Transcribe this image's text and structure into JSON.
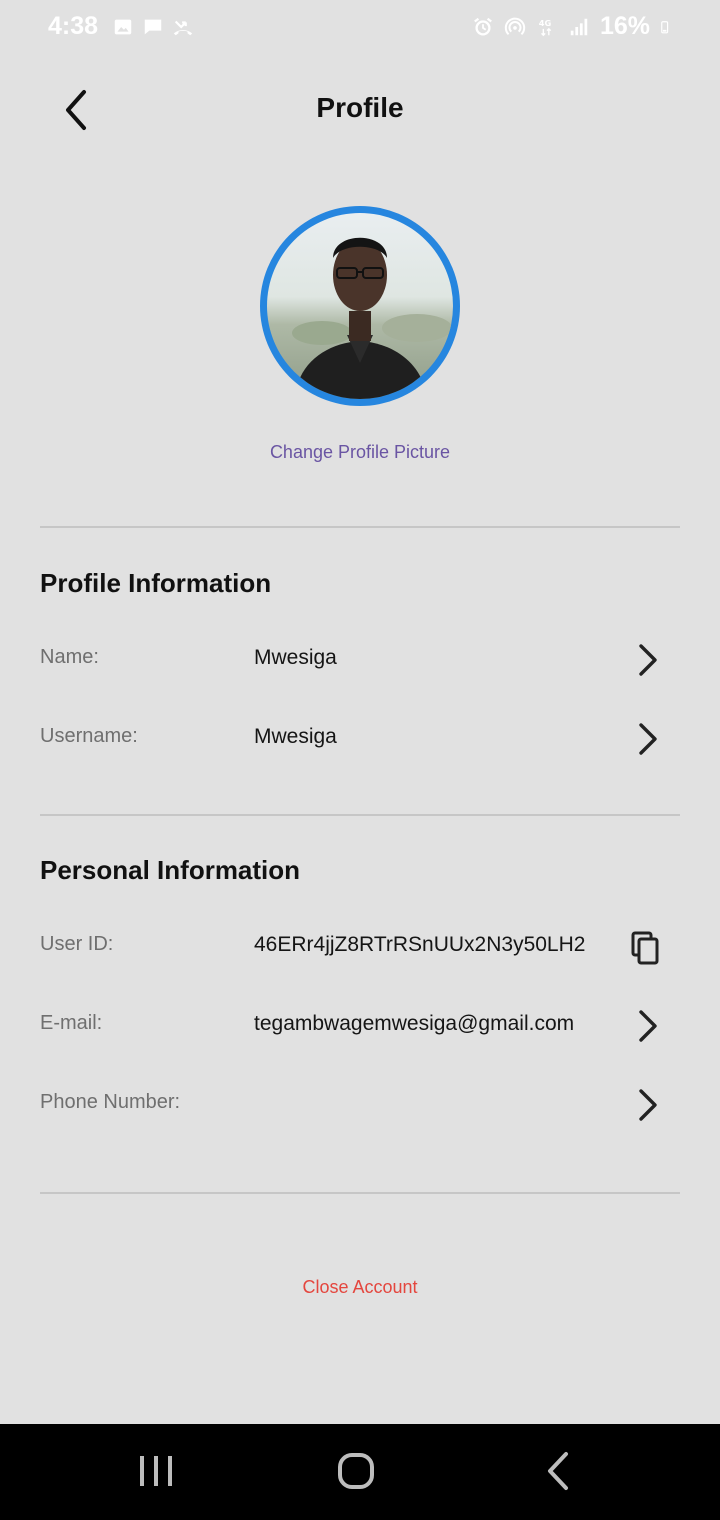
{
  "status_bar": {
    "time": "4:38",
    "battery": "16%",
    "left_icons": [
      "image-icon",
      "message-icon",
      "missed-call-icon"
    ],
    "right_icons": [
      "alarm-icon",
      "hotspot-icon",
      "network-4g-icon",
      "signal-icon",
      "battery-icon"
    ]
  },
  "header": {
    "title": "Profile",
    "back_icon": "chevron-left-icon"
  },
  "profile": {
    "avatar_border_color": "#2686df",
    "change_picture_label": "Change Profile Picture"
  },
  "sections": {
    "profile_info": {
      "title": "Profile Information",
      "rows": [
        {
          "label": "Name:",
          "value": "Mwesiga",
          "action_icon": "chevron-right-icon"
        },
        {
          "label": "Username:",
          "value": "Mwesiga",
          "action_icon": "chevron-right-icon"
        }
      ]
    },
    "personal_info": {
      "title": "Personal Information",
      "rows": [
        {
          "label": "User ID:",
          "value": "46ERr4jjZ8RTrRSnUUx2N3y50LH2",
          "action_icon": "copy-icon"
        },
        {
          "label": "E-mail:",
          "value": "tegambwagemwesiga@gmail.com",
          "action_icon": "chevron-right-icon"
        },
        {
          "label": "Phone Number:",
          "value": "",
          "action_icon": "chevron-right-icon"
        }
      ]
    }
  },
  "close_account_label": "Close Account",
  "colors": {
    "background": "#e1e1e1",
    "accent_link": "#6a55a3",
    "danger": "#e4463e"
  },
  "nav_bar": {
    "buttons": [
      "recents-icon",
      "home-icon",
      "back-icon"
    ]
  }
}
